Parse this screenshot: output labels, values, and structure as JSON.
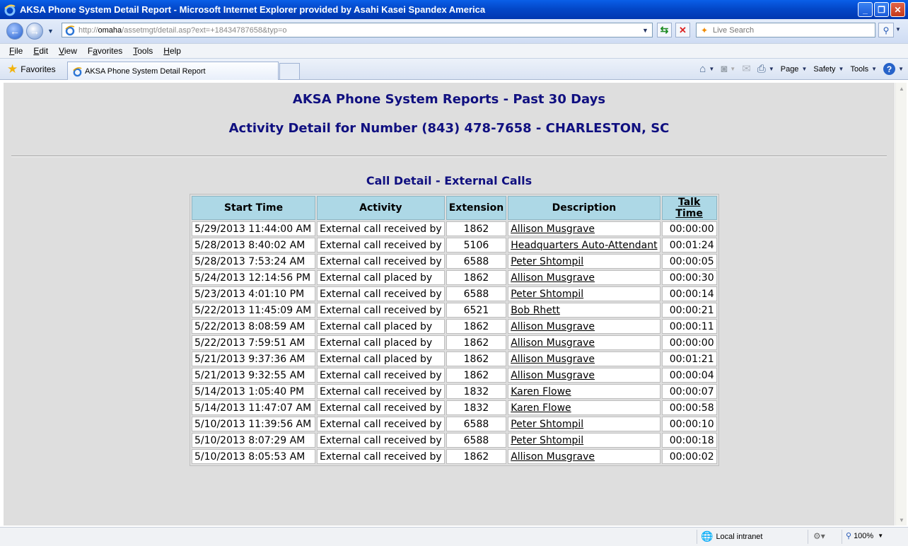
{
  "window": {
    "title": "AKSA Phone System Detail Report - Microsoft Internet Explorer provided by Asahi Kasei Spandex America",
    "buttons": {
      "minimize": "_",
      "maximize": "❐",
      "close": "✕"
    }
  },
  "address_bar": {
    "url_prefix": "http://",
    "url_host": "omaha",
    "url_path": "/assetmgt/detail.asp?ext=+18434787658&typ=o",
    "search_placeholder": "Live Search"
  },
  "menu": [
    "File",
    "Edit",
    "View",
    "Favorites",
    "Tools",
    "Help"
  ],
  "menu_underline": [
    "F",
    "E",
    "V",
    "a",
    "T",
    "H"
  ],
  "favorites_label": "Favorites",
  "tab": {
    "title": "AKSA Phone System Detail Report"
  },
  "command_bar": {
    "page": "Page",
    "safety": "Safety",
    "tools": "Tools"
  },
  "report": {
    "title": "AKSA Phone System Reports - Past 30 Days",
    "subtitle": "Activity Detail for Number (843) 478-7658 - CHARLESTON, SC",
    "section": "Call Detail - External Calls",
    "columns": [
      "Start Time",
      "Activity",
      "Extension",
      "Description",
      "Talk Time"
    ],
    "rows": [
      [
        "5/29/2013 11:44:00 AM",
        "External call received by",
        "1862",
        "Allison Musgrave",
        "00:00:00"
      ],
      [
        "5/28/2013 8:40:02 AM",
        "External call received by",
        "5106",
        "Headquarters Auto-Attendant",
        "00:01:24"
      ],
      [
        "5/28/2013 7:53:24 AM",
        "External call received by",
        "6588",
        "Peter Shtompil",
        "00:00:05"
      ],
      [
        "5/24/2013 12:14:56 PM",
        "External call placed by",
        "1862",
        "Allison Musgrave",
        "00:00:30"
      ],
      [
        "5/23/2013 4:01:10 PM",
        "External call received by",
        "6588",
        "Peter Shtompil",
        "00:00:14"
      ],
      [
        "5/22/2013 11:45:09 AM",
        "External call received by",
        "6521",
        "Bob Rhett",
        "00:00:21"
      ],
      [
        "5/22/2013 8:08:59 AM",
        "External call placed by",
        "1862",
        "Allison Musgrave",
        "00:00:11"
      ],
      [
        "5/22/2013 7:59:51 AM",
        "External call placed by",
        "1862",
        "Allison Musgrave",
        "00:00:00"
      ],
      [
        "5/21/2013 9:37:36 AM",
        "External call placed by",
        "1862",
        "Allison Musgrave",
        "00:01:21"
      ],
      [
        "5/21/2013 9:32:55 AM",
        "External call received by",
        "1862",
        "Allison Musgrave",
        "00:00:04"
      ],
      [
        "5/14/2013 1:05:40 PM",
        "External call received by",
        "1832",
        "Karen Flowe",
        "00:00:07"
      ],
      [
        "5/14/2013 11:47:07 AM",
        "External call received by",
        "1832",
        "Karen Flowe",
        "00:00:58"
      ],
      [
        "5/10/2013 11:39:56 AM",
        "External call received by",
        "6588",
        "Peter Shtompil",
        "00:00:10"
      ],
      [
        "5/10/2013 8:07:29 AM",
        "External call received by",
        "6588",
        "Peter Shtompil",
        "00:00:18"
      ],
      [
        "5/10/2013 8:05:53 AM",
        "External call received by",
        "1862",
        "Allison Musgrave",
        "00:00:02"
      ]
    ]
  },
  "status_bar": {
    "zone": "Local intranet",
    "zoom": "100%"
  },
  "colors": {
    "title_bar": "#0348c9",
    "heading": "#101080",
    "header_cell": "#add8e6",
    "page_bg": "#dedede"
  }
}
